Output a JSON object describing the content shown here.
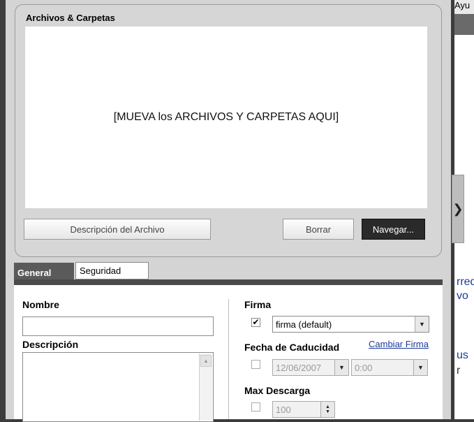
{
  "files_group": {
    "title": "Archivos & Carpetas",
    "drop_zone_text": "[MUEVA los ARCHIVOS Y CARPETAS AQUI]",
    "buttons": {
      "descripcion": "Descripción del Archivo",
      "borrar": "Borrar",
      "navegar": "Navegar..."
    }
  },
  "tabs": [
    {
      "label": "General",
      "active": true
    },
    {
      "label": "Seguridad",
      "active": false
    }
  ],
  "form": {
    "nombre_label": "Nombre",
    "nombre_value": "",
    "descripcion_label": "Descripción",
    "descripcion_value": "",
    "firma_label": "Firma",
    "firma_checked": true,
    "firma_select": "firma (default)",
    "fecha_label": "Fecha de Caducidad",
    "cambiar_firma_link": "Cambiar Firma",
    "fecha_checked": false,
    "fecha_date": "12/06/2007",
    "fecha_time": "0:00",
    "max_label": "Max Descarga",
    "max_checked": false,
    "max_value": "100"
  },
  "right_panel": {
    "header_text": "Ayu",
    "fragment_1": "rred",
    "fragment_2": "vo",
    "fragment_3": "us",
    "fragment_4": "r"
  },
  "icons": {
    "collapse": "chevron-right-icon",
    "dropdown": "triangle-down-icon",
    "check": "check-mark-icon"
  }
}
